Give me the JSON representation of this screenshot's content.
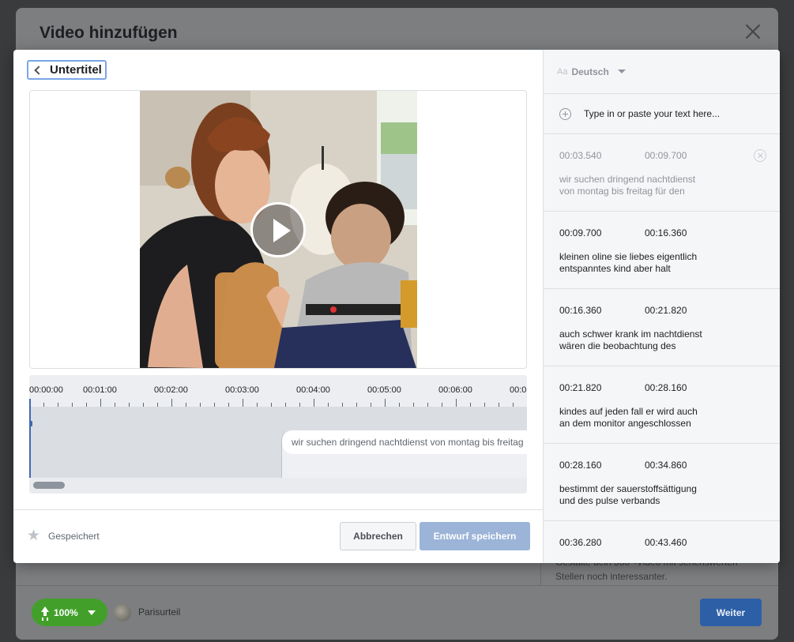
{
  "background": {
    "dialog_title": "Video hinzufügen",
    "side_text": "Gestalte dein 360°-Video mit sehenswerten Stellen noch interessanter.",
    "upload_progress": "100%",
    "page_name": "Parisurteil",
    "next_button": "Weiter"
  },
  "modal": {
    "back_label": "Untertitel",
    "timeline": {
      "ticks": [
        "00:00:00",
        "00:01:00",
        "00:02:00",
        "00:03:00",
        "00:04:00",
        "00:05:00",
        "00:06:00",
        "00:0"
      ],
      "subtitle_preview": "wir suchen dringend nachtdienst von montag bis freitag"
    },
    "footer": {
      "saved_label": "Gespeichert",
      "cancel_label": "Abbrechen",
      "save_draft_label": "Entwurf speichern"
    }
  },
  "captions": {
    "language_icon": "Aa",
    "language": "Deutsch",
    "add_placeholder": "Type in or paste your text here...",
    "cues": [
      {
        "start": "00:03.540",
        "end": "00:09.700",
        "text": "wir suchen dringend nachtdienst\nvon montag bis freitag für den"
      },
      {
        "start": "00:09.700",
        "end": "00:16.360",
        "text": "kleinen oline sie liebes eigentlich\nentspanntes kind aber halt"
      },
      {
        "start": "00:16.360",
        "end": "00:21.820",
        "text": "auch schwer krank im nachtdienst\nwären die beobachtung des"
      },
      {
        "start": "00:21.820",
        "end": "00:28.160",
        "text": "kindes auf jeden fall er wird auch\nan dem monitor angeschlossen"
      },
      {
        "start": "00:28.160",
        "end": "00:34.860",
        "text": "bestimmt der sauerstoffsättigung\nund des pulse verbands"
      },
      {
        "start": "00:36.280",
        "end": "00:43.460",
        "text": ""
      }
    ]
  },
  "colors": {
    "primary": "#4267b2",
    "primary_disabled": "#9cb4d8",
    "upload_green": "#42a02a"
  }
}
